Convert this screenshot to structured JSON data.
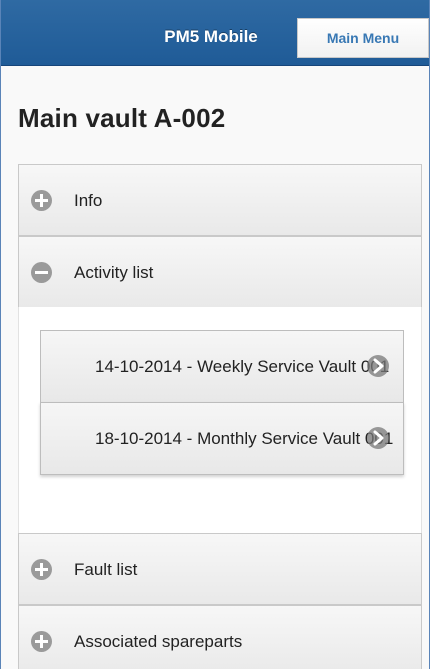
{
  "header": {
    "title": "PM5 Mobile",
    "main_menu_label": "Main Menu"
  },
  "page": {
    "title": "Main vault A-002"
  },
  "sections": [
    {
      "label": "Info",
      "state": "collapsed",
      "icon": "plus-icon"
    },
    {
      "label": "Activity list",
      "state": "expanded",
      "icon": "minus-icon"
    },
    {
      "label": "Fault list",
      "state": "collapsed",
      "icon": "plus-icon"
    },
    {
      "label": "Associated spareparts",
      "state": "collapsed",
      "icon": "plus-icon"
    }
  ],
  "activities": [
    {
      "label": "14-10-2014 - Weekly Service Vault 001",
      "icon": "arrow-right-icon"
    },
    {
      "label": "18-10-2014 - Monthly Service Vault 001",
      "icon": "arrow-right-icon"
    }
  ],
  "colors": {
    "header_bg": "#2f6aa3",
    "accent": "#3878b4",
    "icon_gray": "#9a9a9a"
  }
}
